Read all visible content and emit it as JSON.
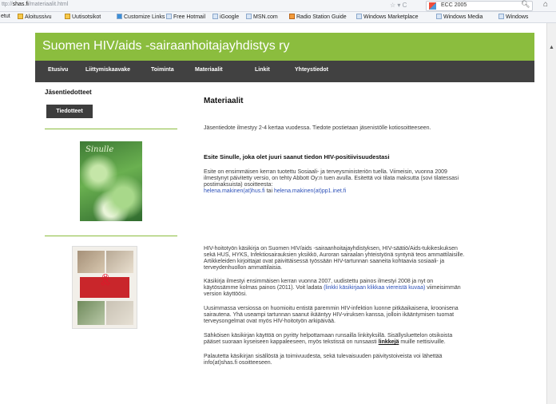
{
  "browser": {
    "url_prefix": "ttp://",
    "url_host": "shas.fi",
    "url_path": "/materiaalit.html",
    "nav_buttons": "☆ ▾ C",
    "search_text": "ECC 2005",
    "bookmarks": [
      "etut",
      "Aloitussivu",
      "Uutisotsikot",
      "Customize Links",
      "Free Hotmail",
      "iGoogle",
      "MSN.com",
      "Radio Station Guide",
      "Windows Marketplace",
      "Windows Media",
      "Windows"
    ]
  },
  "site": {
    "title": "Suomen HIV/aids -sairaanhoitajayhdistys ry",
    "nav": [
      "Etusivu",
      "Liittymiskaavake",
      "Toiminta",
      "Materiaalit",
      "Linkit",
      "Yhteystiedot"
    ]
  },
  "sidebar": {
    "title": "Jäsentiedotteet",
    "button": "Tiedotteet",
    "cover1_title": "Sinulle"
  },
  "main": {
    "title": "Materiaalit",
    "p1": "Jäsentiedote ilmestyy 2-4 kertaa vuodessa. Tiedote postietaan jäsenistölle kotiosoitteeseen.",
    "heading2": "Esite Sinulle, joka olet juuri saanut tiedon HIV-positiivisuudestasi",
    "p2": "Esite on ensimmäisen kerran tuotettu Sosiaali- ja terveysministeriön tuella. Viimeisin, vuonna 2009 ilmestynyt päivitetty versio, on tehty Abbott Oy:n tuen avulla. Esitettä voi tilata maksutta (sovi tilatessasi postimaksuista) osoitteesta:",
    "link1": "helena.makinen(at)hus.fi",
    "or": " tai ",
    "link2": "helena.makinen(at)pp1.inet.fi",
    "p3": "HIV-hoitotyön käsikirja on Suomen HIV/aids -sairaanhoitajayhdistyksen, HIV-säätiö/Aids-tukikeskuksen sekä HUS, HYKS, Infektiosairauksien yksikkö, Auroran sairaalan yhteistyönä syntynä teos ammattilaisille. Artikkeleiden kirjoittajat ovat päivittäisessä työssään HIV-tartunnan saaneita kohtaavia sosiaali- ja terveydenhuollon ammattilaisia.",
    "p4a": "Käsikirja ilmestyi ensimmäisen kerran vuonna 2007, uudistettu painos ilmestyi 2008 ja nyt on käytössämme kolmas painos (2011). Voit ladata",
    "link3": "(linkki käsikirjaan klikkaa viereistä kuvaa)",
    "p4b": " viimeisimmän version käyttöösi.",
    "p5": "Uusimmassa versiossa on huomioitu entistä paremmin HIV-infektion luonne pitkäaikaisena, kroonisena sairautena. Yhä useampi tartunnan saanut ikääntyy HIV-viruksen kanssa, jolloin ikääntymisen tuomat terveysongelmat ovat myös HIV-hoitotyön arkipäivää.",
    "p6a": "Sähköisen käsikirjan käyttöä on pyritty helpottamaan runsailla linkityksillä. Sisällysluettelon otsikoista pääset suoraan kyseiseen kappaleeseen, myös tekstissä on runsaasti ",
    "p6link": "linkkejä",
    "p6b": " muille nettisivuille.",
    "p7": "Palautetta käsikirjan sisällöstä ja toimivuudesta, sekä tulevaisuuden päivitystoiveista voi lähettää info(at)shas.fi osoitteeseen."
  },
  "colors": {
    "brand_green": "#8bbd3e",
    "nav_dark": "#414141"
  }
}
